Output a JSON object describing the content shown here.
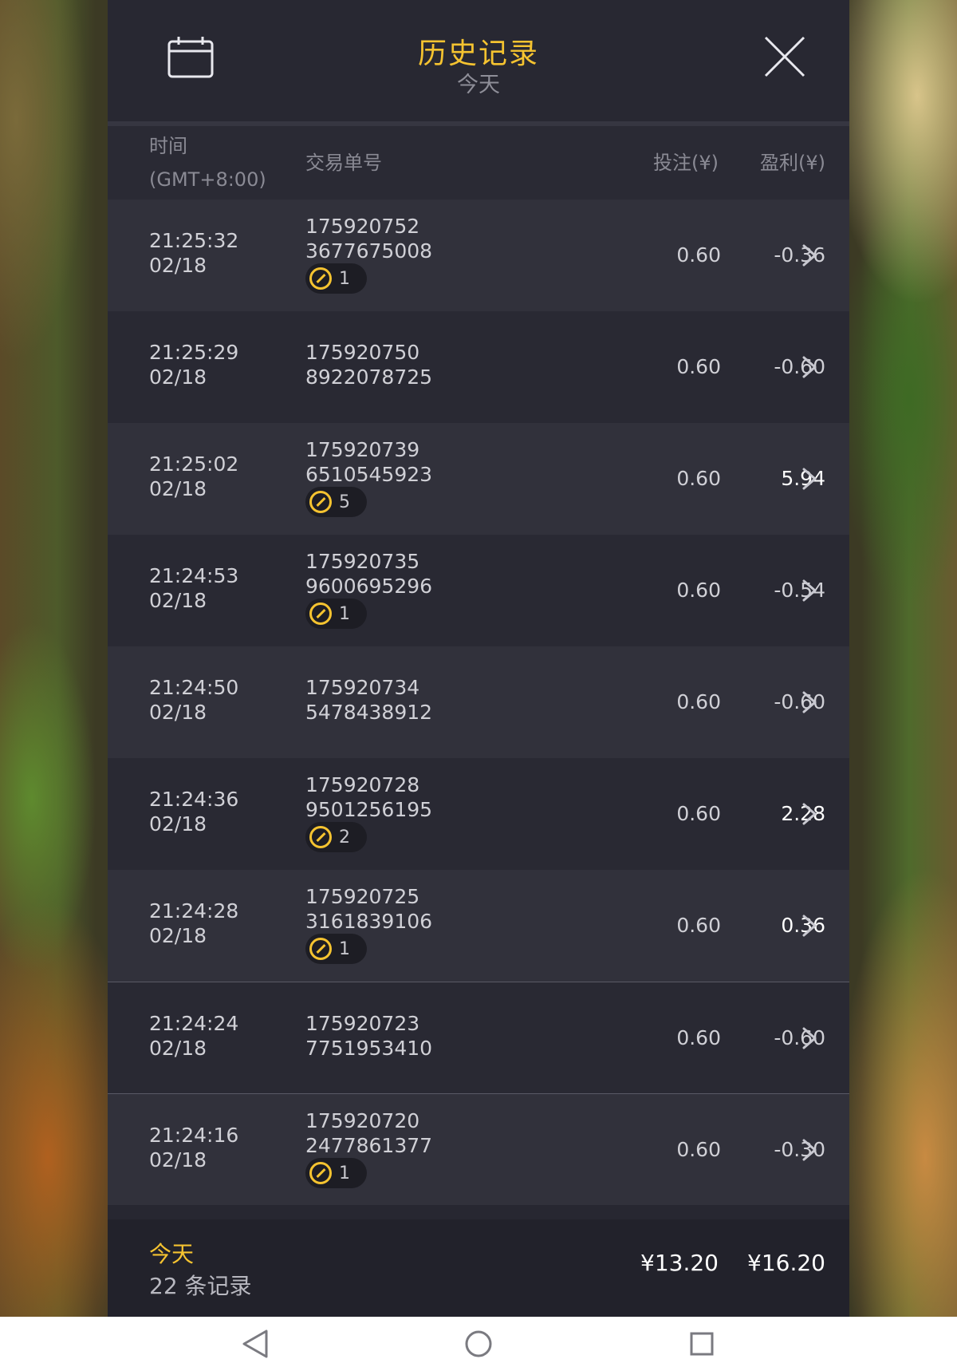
{
  "header": {
    "title": "历史记录",
    "subtitle": "今天",
    "calendar_icon": "calendar-icon",
    "close_icon": "close-icon"
  },
  "columns": {
    "time_line1": "时间",
    "time_line2": "(GMT+8:00)",
    "order": "交易单号",
    "bet": "投注(¥)",
    "profit": "盈利(¥)"
  },
  "rows": [
    {
      "time": "21:25:32",
      "date": "02/18",
      "order1": "175920752",
      "order2": "3677675008",
      "badge": "1",
      "bet": "0.60",
      "profit": "-0.36",
      "positive": false
    },
    {
      "time": "21:25:29",
      "date": "02/18",
      "order1": "175920750",
      "order2": "8922078725",
      "badge": null,
      "bet": "0.60",
      "profit": "-0.60",
      "positive": false
    },
    {
      "time": "21:25:02",
      "date": "02/18",
      "order1": "175920739",
      "order2": "6510545923",
      "badge": "5",
      "bet": "0.60",
      "profit": "5.94",
      "positive": true
    },
    {
      "time": "21:24:53",
      "date": "02/18",
      "order1": "175920735",
      "order2": "9600695296",
      "badge": "1",
      "bet": "0.60",
      "profit": "-0.54",
      "positive": false
    },
    {
      "time": "21:24:50",
      "date": "02/18",
      "order1": "175920734",
      "order2": "5478438912",
      "badge": null,
      "bet": "0.60",
      "profit": "-0.60",
      "positive": false
    },
    {
      "time": "21:24:36",
      "date": "02/18",
      "order1": "175920728",
      "order2": "9501256195",
      "badge": "2",
      "bet": "0.60",
      "profit": "2.28",
      "positive": true
    },
    {
      "time": "21:24:28",
      "date": "02/18",
      "order1": "175920725",
      "order2": "3161839106",
      "badge": "1",
      "bet": "0.60",
      "profit": "0.36",
      "positive": true
    },
    {
      "time": "21:24:24",
      "date": "02/18",
      "order1": "175920723",
      "order2": "7751953410",
      "badge": null,
      "bet": "0.60",
      "profit": "-0.60",
      "positive": false
    },
    {
      "time": "21:24:16",
      "date": "02/18",
      "order1": "175920720",
      "order2": "2477861377",
      "badge": "1",
      "bet": "0.60",
      "profit": "-0.30",
      "positive": false
    }
  ],
  "footer": {
    "label": "今天",
    "count": "22 条记录",
    "total_bet": "¥13.20",
    "total_profit": "¥16.20"
  },
  "navbar": {
    "back_icon": "back-triangle-icon",
    "home_icon": "home-circle-icon",
    "recent_icon": "recent-apps-square-icon"
  },
  "colors": {
    "accent": "#f5c330",
    "panel": "#272731",
    "row_odd": "#31313b",
    "row_even": "#292933"
  }
}
